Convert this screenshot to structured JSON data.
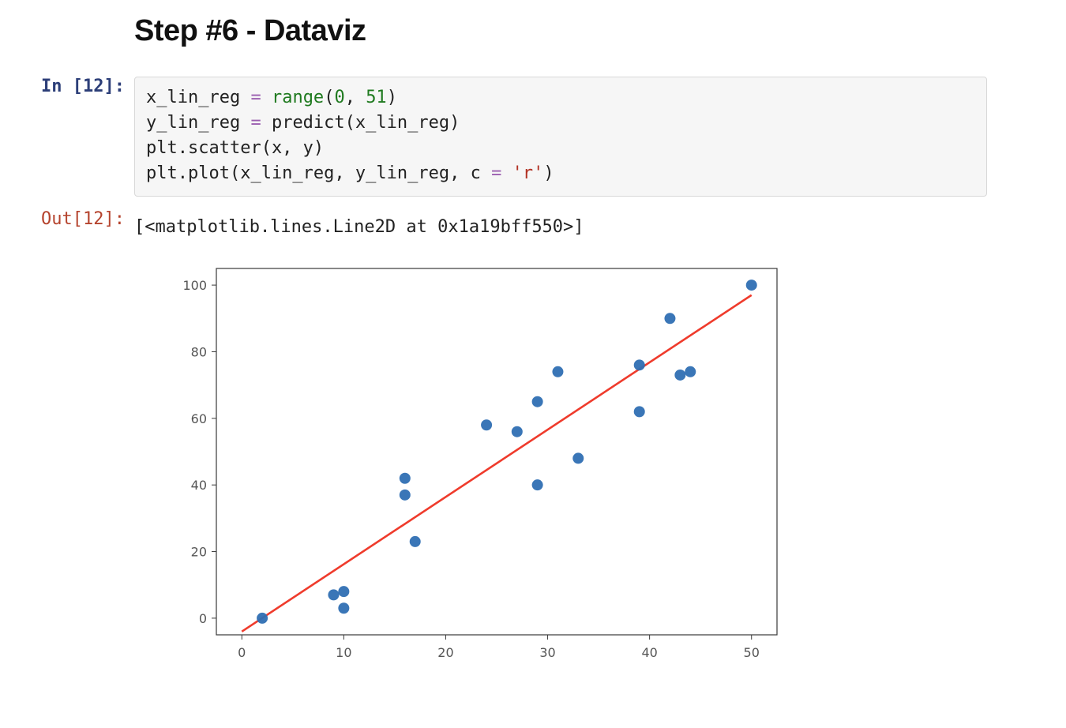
{
  "heading": "Step #6 - Dataviz",
  "cell": {
    "in_prompt": "In [12]:",
    "out_prompt": "Out[12]:",
    "code_tokens": [
      {
        "t": "x_lin_reg ",
        "c": ""
      },
      {
        "t": "=",
        "c": "tok-op"
      },
      {
        "t": " ",
        "c": ""
      },
      {
        "t": "range",
        "c": "tok-func"
      },
      {
        "t": "(",
        "c": ""
      },
      {
        "t": "0",
        "c": "tok-num"
      },
      {
        "t": ", ",
        "c": ""
      },
      {
        "t": "51",
        "c": "tok-num"
      },
      {
        "t": ")\n",
        "c": ""
      },
      {
        "t": "y_lin_reg ",
        "c": ""
      },
      {
        "t": "=",
        "c": "tok-op"
      },
      {
        "t": " predict(x_lin_reg)\n",
        "c": ""
      },
      {
        "t": "plt.scatter(x, y)\n",
        "c": ""
      },
      {
        "t": "plt.plot(x_lin_reg, y_lin_reg, c ",
        "c": ""
      },
      {
        "t": "=",
        "c": "tok-op"
      },
      {
        "t": " ",
        "c": ""
      },
      {
        "t": "'r'",
        "c": "tok-str"
      },
      {
        "t": ")",
        "c": ""
      }
    ],
    "out_text": "[<matplotlib.lines.Line2D at 0x1a19bff550>]"
  },
  "chart_data": {
    "type": "scatter",
    "xlim": [
      -2.5,
      52.5
    ],
    "ylim": [
      -5,
      105
    ],
    "x_ticks": [
      0,
      10,
      20,
      30,
      40,
      50
    ],
    "y_ticks": [
      0,
      20,
      40,
      60,
      80,
      100
    ],
    "x_tick_labels": [
      "0",
      "10",
      "20",
      "30",
      "40",
      "50"
    ],
    "y_tick_labels": [
      "0",
      "20",
      "40",
      "60",
      "80",
      "100"
    ],
    "scatter": [
      {
        "x": 2,
        "y": 0
      },
      {
        "x": 9,
        "y": 7
      },
      {
        "x": 10,
        "y": 8
      },
      {
        "x": 10,
        "y": 3
      },
      {
        "x": 16,
        "y": 42
      },
      {
        "x": 16,
        "y": 37
      },
      {
        "x": 17,
        "y": 23
      },
      {
        "x": 24,
        "y": 58
      },
      {
        "x": 27,
        "y": 56
      },
      {
        "x": 29,
        "y": 65
      },
      {
        "x": 29,
        "y": 40
      },
      {
        "x": 31,
        "y": 74
      },
      {
        "x": 33,
        "y": 48
      },
      {
        "x": 39,
        "y": 76
      },
      {
        "x": 39,
        "y": 62
      },
      {
        "x": 42,
        "y": 90
      },
      {
        "x": 43,
        "y": 73
      },
      {
        "x": 44,
        "y": 74
      },
      {
        "x": 50,
        "y": 100
      }
    ],
    "reg_line": {
      "x0": 0,
      "y0": -4,
      "x1": 50,
      "y1": 97
    },
    "line_color": "#ef3b2c",
    "point_color": "#2f6fb3"
  }
}
